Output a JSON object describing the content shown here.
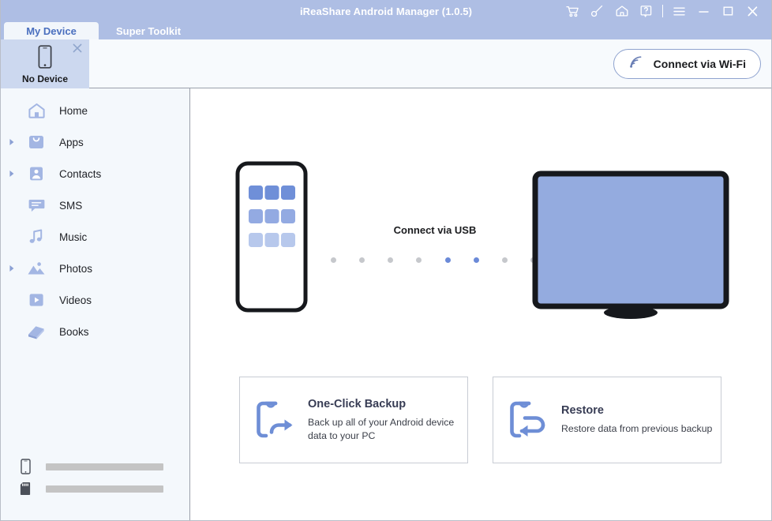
{
  "window": {
    "title": "iReaShare Android Manager (1.0.5)",
    "accent": "#aebee4",
    "controls": [
      {
        "name": "cart-icon",
        "label": "Cart"
      },
      {
        "name": "key-icon",
        "label": "Register"
      },
      {
        "name": "home-icon",
        "label": "Home"
      },
      {
        "name": "help-icon",
        "label": "Help"
      },
      {
        "name": "menu-icon",
        "label": "Menu"
      },
      {
        "name": "minimize-icon",
        "label": "Minimize"
      },
      {
        "name": "maximize-icon",
        "label": "Maximize"
      },
      {
        "name": "close-icon",
        "label": "Close"
      }
    ]
  },
  "tabs": [
    {
      "label": "My Device",
      "active": true
    },
    {
      "label": "Super Toolkit",
      "active": false
    }
  ],
  "device_bar": {
    "device_label": "No Device",
    "close_label": "×",
    "wifi_button": "Connect via Wi-Fi"
  },
  "sidebar": {
    "items": [
      {
        "label": "Home",
        "icon": "home-icon",
        "expandable": false
      },
      {
        "label": "Apps",
        "icon": "apps-icon",
        "expandable": true
      },
      {
        "label": "Contacts",
        "icon": "contacts-icon",
        "expandable": true
      },
      {
        "label": "SMS",
        "icon": "sms-icon",
        "expandable": false
      },
      {
        "label": "Music",
        "icon": "music-icon",
        "expandable": false
      },
      {
        "label": "Photos",
        "icon": "photos-icon",
        "expandable": true
      },
      {
        "label": "Videos",
        "icon": "videos-icon",
        "expandable": false
      },
      {
        "label": "Books",
        "icon": "books-icon",
        "expandable": false
      }
    ],
    "storage": [
      {
        "name": "internal-storage",
        "icon": "phone-icon",
        "fill_percent": 0
      },
      {
        "name": "sd-card-storage",
        "icon": "sdcard-icon",
        "fill_percent": 0
      }
    ]
  },
  "main": {
    "connect_label": "Connect via USB",
    "dots": [
      false,
      false,
      false,
      false,
      true,
      true,
      false,
      false
    ],
    "cards": [
      {
        "title": "One-Click Backup",
        "desc": "Back up all of your Android device data to your PC",
        "icon": "backup-icon"
      },
      {
        "title": "Restore",
        "desc": "Restore data from previous backup",
        "icon": "restore-icon"
      }
    ]
  }
}
